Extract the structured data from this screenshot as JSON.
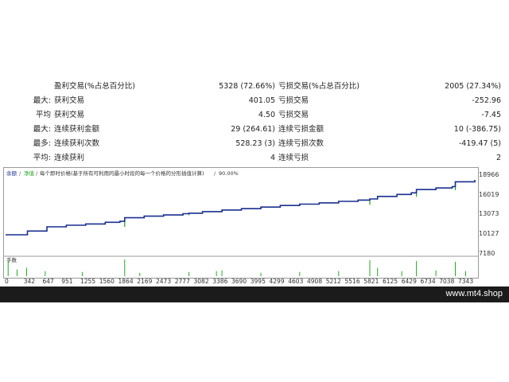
{
  "stats": {
    "rows": [
      {
        "prefix": "",
        "label": "盈利交易(%占总百分比)",
        "value": "5328 (72.66%)",
        "rlabel": "亏损交易(%占总百分比)",
        "rvalue": "2005 (27.34%)"
      },
      {
        "prefix": "最大:",
        "label": "获利交易",
        "value": "401.05",
        "rlabel": "亏损交易",
        "rvalue": "-252.96"
      },
      {
        "prefix": "平均",
        "label": "获利交易",
        "value": "4.50",
        "rlabel": "亏损交易",
        "rvalue": "-7.45"
      },
      {
        "prefix": "最大:",
        "label": "连续获利金额",
        "value": "29 (264.61)",
        "rlabel": "连续亏损金额",
        "rvalue": "10 (-386.75)"
      },
      {
        "prefix": "最多:",
        "label": "连续获利次数",
        "value": "528.23 (3)",
        "rlabel": "连续亏损次数",
        "rvalue": "-419.47 (5)"
      },
      {
        "prefix": "平均:",
        "label": "连续获利",
        "value": "4",
        "rlabel": "连续亏损",
        "rvalue": "2"
      }
    ]
  },
  "chart": {
    "legend_balance": "余额",
    "legend_equity": "净值",
    "legend_text": "每个即时价格(基于所有可利用的最小时段的每一个价格的分形插值计算)",
    "legend_quality": "90.00%",
    "volume_label": "手数",
    "colors": {
      "balance": "#1a2f8f",
      "equity": "#1fa21f",
      "volume": "#22aa22",
      "legend_balance": "#1a2f8f",
      "legend_equity": "#1fa21f"
    }
  },
  "chart_data": {
    "type": "line",
    "y_ticks": [
      "18966",
      "16019",
      "13073",
      "10127",
      "7180"
    ],
    "x_ticks": [
      "0",
      "342",
      "647",
      "951",
      "1255",
      "1560",
      "1864",
      "2169",
      "2473",
      "2777",
      "3082",
      "3386",
      "3690",
      "3995",
      "4299",
      "4603",
      "4908",
      "5212",
      "5516",
      "5821",
      "6125",
      "6429",
      "6734",
      "7038",
      "7343"
    ],
    "ylim": [
      7180,
      18966
    ],
    "xlim": [
      0,
      7343
    ],
    "series": [
      {
        "name": "余额",
        "x": [
          0,
          342,
          647,
          951,
          1255,
          1560,
          1790,
          1864,
          2169,
          2473,
          2777,
          2870,
          3082,
          3386,
          3690,
          3995,
          4299,
          4603,
          4908,
          5212,
          5516,
          5700,
          5821,
          6125,
          6350,
          6429,
          6734,
          6990,
          7038,
          7343
        ],
        "y": [
          10127,
          10700,
          11350,
          11600,
          11800,
          12050,
          12200,
          12750,
          13000,
          13180,
          13380,
          13450,
          13700,
          13950,
          14150,
          14400,
          14650,
          14850,
          15050,
          15280,
          15480,
          15650,
          16050,
          16350,
          16600,
          17100,
          17350,
          17550,
          18300,
          18600
        ]
      }
    ],
    "volume_spikes": [
      {
        "x": 40,
        "v": 0.9
      },
      {
        "x": 180,
        "v": 0.4
      },
      {
        "x": 330,
        "v": 0.5
      },
      {
        "x": 620,
        "v": 0.3
      },
      {
        "x": 1200,
        "v": 0.25
      },
      {
        "x": 1864,
        "v": 1.0
      },
      {
        "x": 2100,
        "v": 0.2
      },
      {
        "x": 2870,
        "v": 0.25
      },
      {
        "x": 3300,
        "v": 0.3
      },
      {
        "x": 3386,
        "v": 0.35
      },
      {
        "x": 3995,
        "v": 0.2
      },
      {
        "x": 4603,
        "v": 0.25
      },
      {
        "x": 5212,
        "v": 0.3
      },
      {
        "x": 5700,
        "v": 0.95
      },
      {
        "x": 5821,
        "v": 0.5
      },
      {
        "x": 6200,
        "v": 0.3
      },
      {
        "x": 6429,
        "v": 0.9
      },
      {
        "x": 6734,
        "v": 0.35
      },
      {
        "x": 7038,
        "v": 0.85
      },
      {
        "x": 7200,
        "v": 0.3
      }
    ],
    "equity_dips": [
      {
        "x": 1864,
        "depth": 1400
      },
      {
        "x": 2870,
        "depth": 300
      },
      {
        "x": 3386,
        "depth": 250
      },
      {
        "x": 5700,
        "depth": 900
      },
      {
        "x": 5821,
        "depth": 500
      },
      {
        "x": 6429,
        "depth": 1100
      },
      {
        "x": 7038,
        "depth": 1300
      }
    ]
  },
  "footer": {
    "watermark": "www.mt4.shop"
  }
}
